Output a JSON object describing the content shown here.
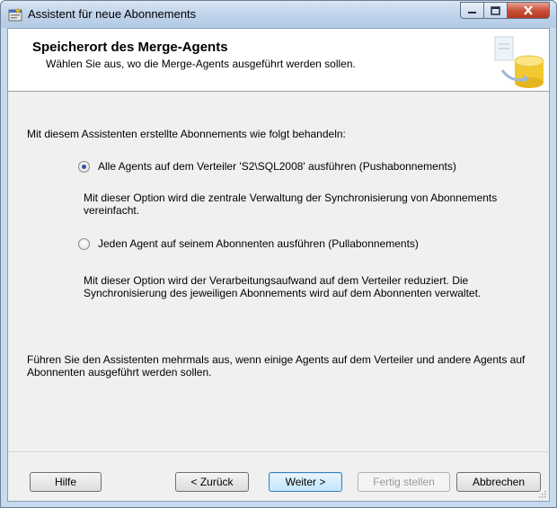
{
  "window": {
    "title": "Assistent für neue Abonnements"
  },
  "header": {
    "title": "Speicherort des Merge-Agents",
    "subtitle": "Wählen Sie aus, wo die Merge-Agents ausgeführt werden sollen."
  },
  "main": {
    "intro": "Mit diesem Assistenten erstellte Abonnements wie folgt behandeln:",
    "options": [
      {
        "label": "Alle Agents auf dem Verteiler 'S2\\SQL2008' ausführen (Pushabonnements)",
        "selected": true,
        "description": "Mit dieser Option wird die zentrale Verwaltung der Synchronisierung von Abonnements vereinfacht."
      },
      {
        "label": "Jeden Agent auf seinem Abonnenten ausführen (Pullabonnements)",
        "selected": false,
        "description": "Mit dieser Option wird der Verarbeitungsaufwand auf dem Verteiler reduziert. Die Synchronisierung des jeweiligen Abonnements wird auf dem Abonnenten verwaltet."
      }
    ],
    "note": "Führen Sie den Assistenten mehrmals aus, wenn einige Agents auf dem Verteiler und andere Agents auf Abonnenten ausgeführt werden sollen."
  },
  "footer": {
    "help": "Hilfe",
    "back": "< Zurück",
    "next": "Weiter >",
    "finish": "Fertig stellen",
    "cancel": "Abbrechen"
  },
  "colors": {
    "radio_selected": "#2b55a3",
    "close_button": "#c9523b"
  }
}
